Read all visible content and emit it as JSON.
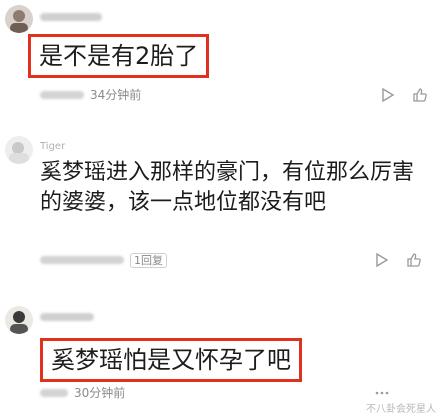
{
  "comments": [
    {
      "text": "是不是有2胎了",
      "time": "34分钟前",
      "highlighted": true
    },
    {
      "username": "Tiger",
      "text_line1": "奚梦瑶进入那样的豪门，有位那么厉害",
      "text_line2": "的婆婆，该一点地位都没有吧",
      "reply_count": "1回复",
      "highlighted": false
    },
    {
      "text": "奚梦瑶怕是又怀孕了吧",
      "time": "30分钟前",
      "highlighted": true
    }
  ],
  "icons": [
    "play-icon",
    "like-icon",
    "more-icon"
  ],
  "watermark": "不八卦会死星人",
  "colors": {
    "highlight_border": "#e0301e",
    "meta_text": "#8a8a8a"
  }
}
